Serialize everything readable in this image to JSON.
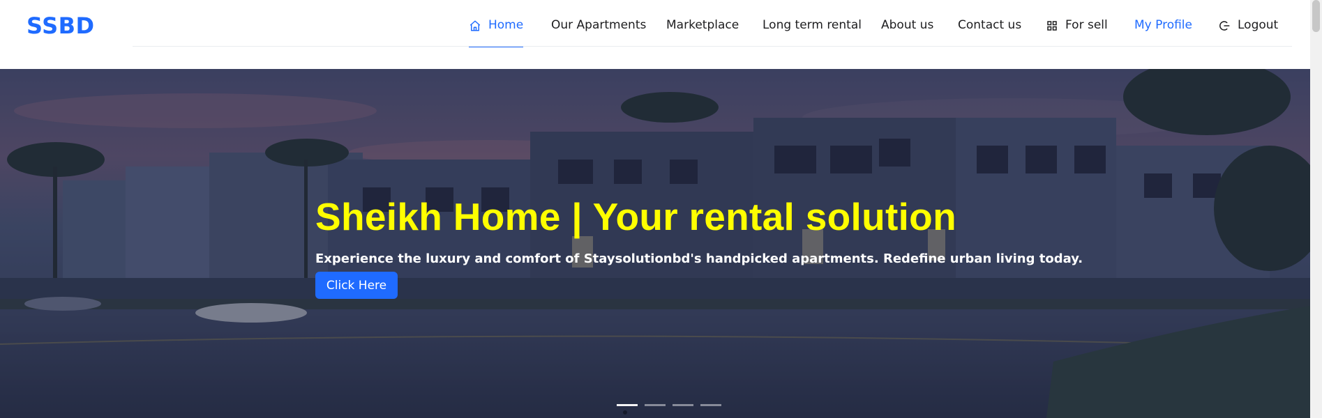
{
  "brand": {
    "name": "SSBD"
  },
  "nav": {
    "items": [
      {
        "label": "Home",
        "icon": "home-icon"
      },
      {
        "label": "Our Apartments"
      },
      {
        "label": "Marketplace"
      },
      {
        "label": "Long term rental"
      },
      {
        "label": "About us"
      },
      {
        "label": "Contact us"
      },
      {
        "label": "For sell",
        "icon": "grid-icon"
      },
      {
        "label": "My Profile"
      },
      {
        "label": "Logout",
        "icon": "logout-icon"
      }
    ],
    "active": "Home"
  },
  "hero": {
    "title": "Sheikh Home | Your rental solution",
    "subtitle": "Experience the luxury and comfort of Staysolutionbd's handpicked apartments. Redefine urban living today.",
    "button_label": "Click Here",
    "slides": 4,
    "active_slide": 1
  },
  "colors": {
    "brand": "#1f6bff",
    "title": "#ffff00",
    "button": "#1f6bff",
    "text_dark": "#1d1d1f"
  }
}
